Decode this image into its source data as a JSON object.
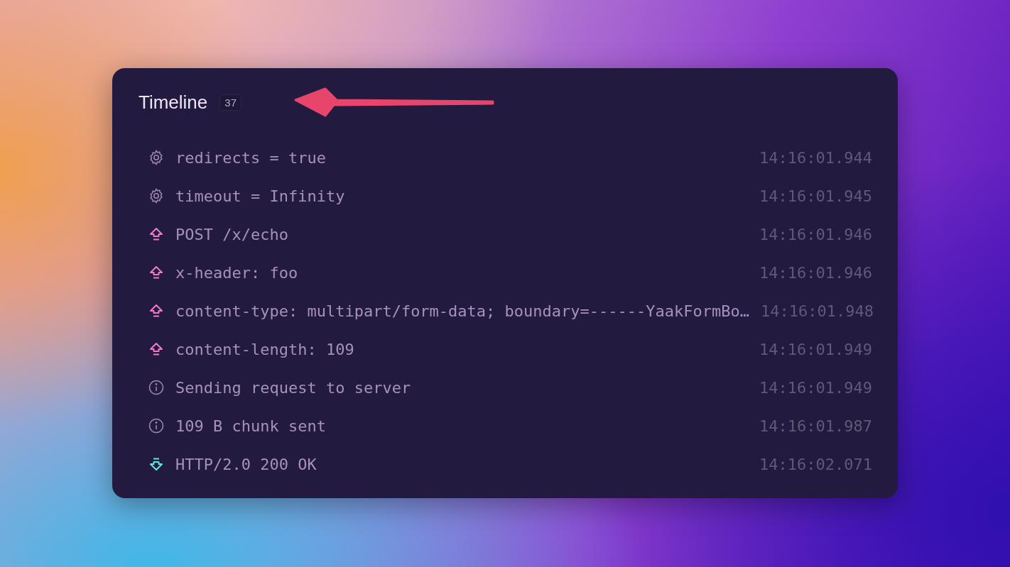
{
  "panel": {
    "title": "Timeline",
    "count": "37"
  },
  "events": [
    {
      "kind": "setting",
      "text": "redirects = true",
      "time": "14:16:01.944"
    },
    {
      "kind": "setting",
      "text": "timeout = Infinity",
      "time": "14:16:01.945"
    },
    {
      "kind": "send",
      "text": "POST /x/echo",
      "time": "14:16:01.946"
    },
    {
      "kind": "send",
      "text": "x-header: foo",
      "time": "14:16:01.946"
    },
    {
      "kind": "send",
      "text": "content-type: multipart/form-data; boundary=------YaakFormBo…",
      "time": "14:16:01.948"
    },
    {
      "kind": "send",
      "text": "content-length: 109",
      "time": "14:16:01.949"
    },
    {
      "kind": "info",
      "text": "Sending request to server",
      "time": "14:16:01.949"
    },
    {
      "kind": "info",
      "text": "109 B chunk sent",
      "time": "14:16:01.987"
    },
    {
      "kind": "receive",
      "text": "HTTP/2.0 200 OK",
      "time": "14:16:02.071"
    }
  ]
}
